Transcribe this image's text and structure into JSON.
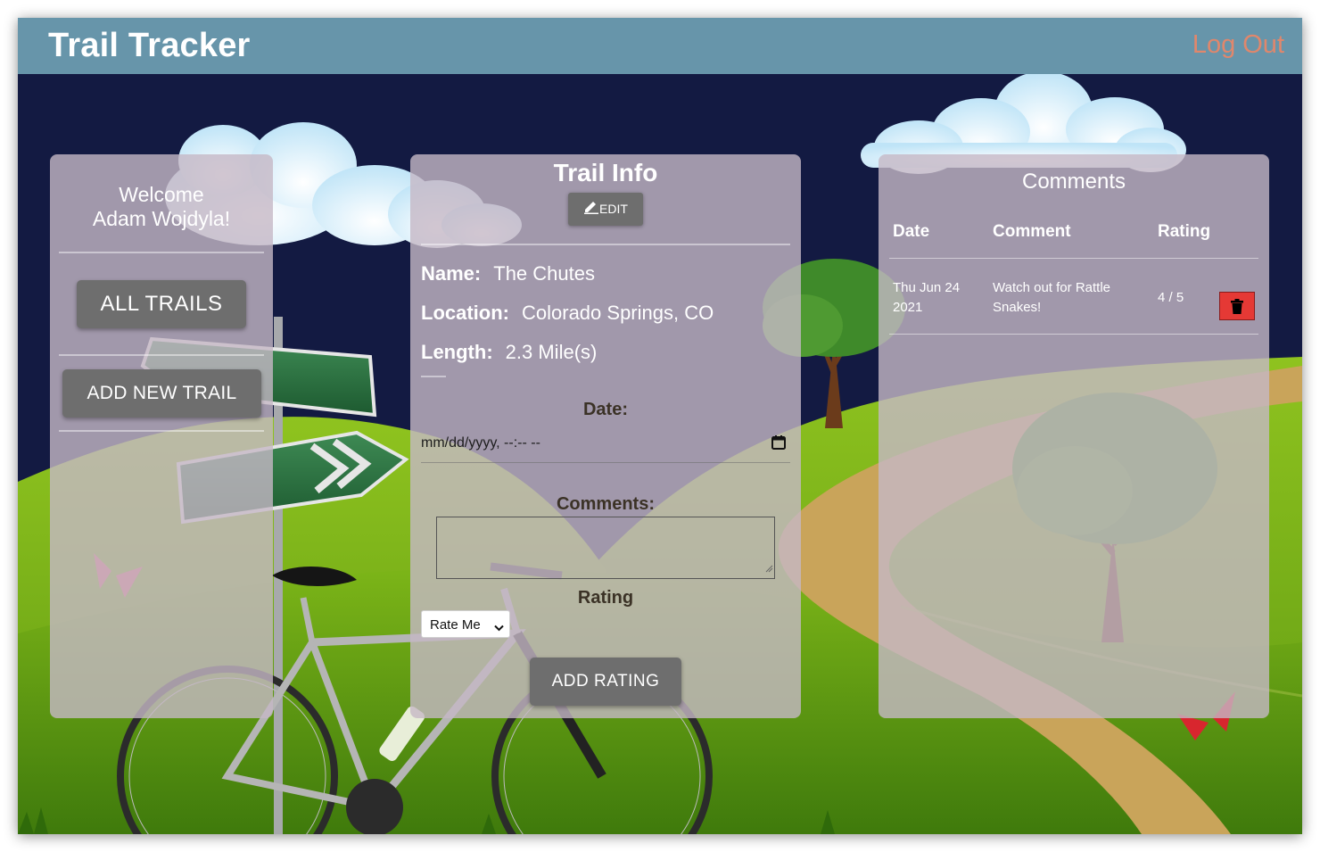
{
  "app": {
    "title": "Trail Tracker",
    "logout_label": "Log Out"
  },
  "sidebar": {
    "welcome_line1": "Welcome",
    "welcome_line2": "Adam Wojdyla!",
    "all_trails_label": "ALL TRAILS",
    "add_trail_label": "ADD NEW TRAIL"
  },
  "trail_info": {
    "title": "Trail Info",
    "edit_label": "EDIT",
    "name_key": "Name:",
    "name_value": "The Chutes",
    "location_key": "Location:",
    "location_value": "Colorado Springs, CO",
    "length_key": "Length:",
    "length_value": "2.3 Mile(s)"
  },
  "rating_form": {
    "date_label": "Date:",
    "date_placeholder": "mm/dd/yyyy, --:-- --",
    "comments_label": "Comments:",
    "rating_label": "Rating",
    "rating_select_value": "Rate Me",
    "submit_label": "ADD RATING"
  },
  "comments": {
    "title": "Comments",
    "columns": [
      "Date",
      "Comment",
      "Rating"
    ],
    "rows": [
      {
        "date_line1": "Thu Jun 24",
        "date_line2": "2021",
        "comment_line1": "Watch out for Rattle",
        "comment_line2": "Snakes!",
        "rating": "4 / 5"
      }
    ]
  },
  "colors": {
    "navbar": "#6795aa",
    "logout": "#e0876c",
    "sky": "#131a42",
    "grass": "#7cb518",
    "panel": "#c5b8c6",
    "button": "#6e6e6e",
    "delete": "#e53935"
  },
  "icons": {
    "edit": "pencil-icon",
    "date": "calendar-icon",
    "select": "chevron-down-icon",
    "delete": "trash-icon"
  }
}
